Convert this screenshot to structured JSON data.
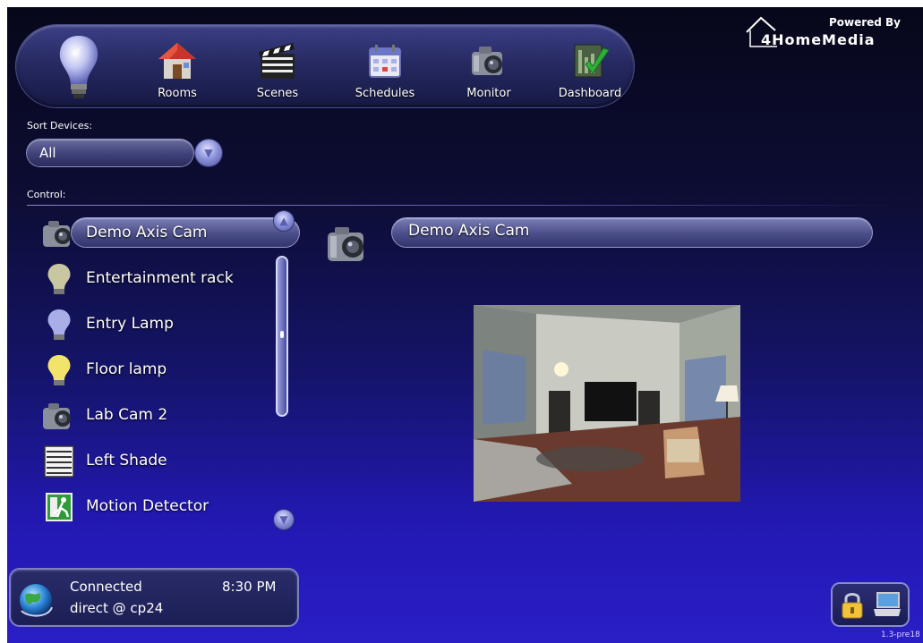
{
  "brand": {
    "powered_by": "Powered By",
    "name": "4HomeMedia"
  },
  "nav": {
    "items": [
      {
        "label": "Rooms",
        "icon": "house-icon"
      },
      {
        "label": "Scenes",
        "icon": "clapperboard-icon"
      },
      {
        "label": "Schedules",
        "icon": "calendar-icon"
      },
      {
        "label": "Monitor",
        "icon": "camera-icon"
      },
      {
        "label": "Dashboard",
        "icon": "dashboard-check-icon"
      }
    ],
    "home_icon": "light-bulb-icon"
  },
  "sort": {
    "label": "Sort Devices:",
    "selected": "All"
  },
  "control": {
    "label": "Control:",
    "devices": [
      {
        "label": "Demo Axis Cam",
        "icon": "camera-icon",
        "selected": true
      },
      {
        "label": "Entertainment rack",
        "icon": "bulb-off-icon"
      },
      {
        "label": "Entry Lamp",
        "icon": "bulb-blue-icon"
      },
      {
        "label": "Floor lamp",
        "icon": "bulb-on-icon"
      },
      {
        "label": "Lab Cam 2",
        "icon": "camera-icon"
      },
      {
        "label": "Left Shade",
        "icon": "shade-icon"
      },
      {
        "label": "Motion Detector",
        "icon": "motion-exit-icon"
      }
    ]
  },
  "detail": {
    "name": "Demo Axis Cam",
    "icon": "camera-icon",
    "feed": "camera-live-feed"
  },
  "status": {
    "connection": "Connected",
    "time": "8:30 PM",
    "route": "direct @ cp24"
  },
  "version": "1.3-pre18",
  "colors": {
    "accent": "#2a1ec6",
    "panel": "#3e4079",
    "highlight": "#9a9cd0"
  }
}
